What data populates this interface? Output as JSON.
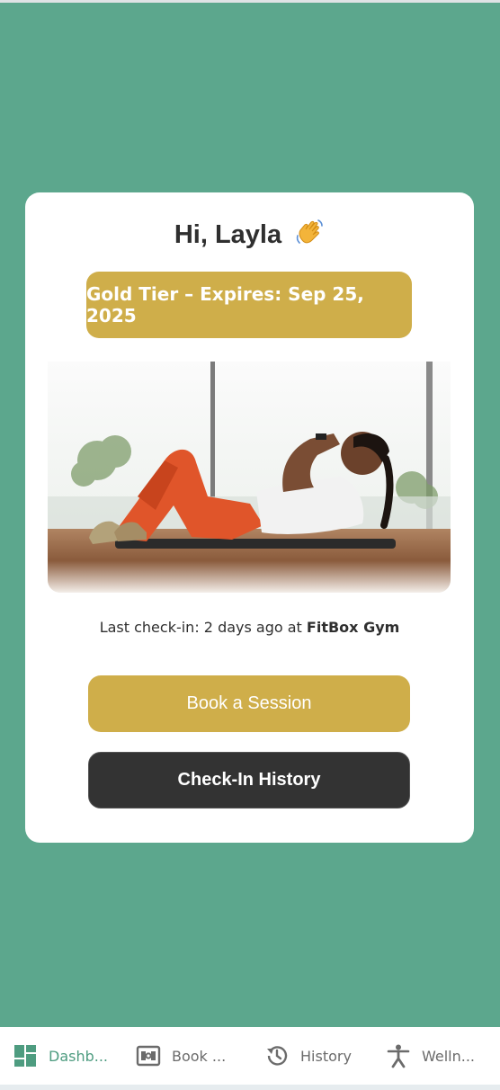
{
  "greeting": {
    "text": "Hi, Layla",
    "icon": "waving-hand-icon"
  },
  "membership": {
    "tier_text": "Gold Tier – Expires: Sep 25, 2025"
  },
  "hero_image": {
    "icon": "woman-doing-crunches-photo"
  },
  "last_checkin": {
    "prefix": "Last check-in: 2 days ago at ",
    "gym": "FitBox Gym"
  },
  "actions": {
    "book_label": "Book a Session",
    "history_label": "Check-In History"
  },
  "nav": {
    "items": [
      {
        "label": "Dashb...",
        "icon": "dashboard-icon",
        "active": true
      },
      {
        "label": "Book ...",
        "icon": "calendar-board-icon",
        "active": false
      },
      {
        "label": "History",
        "icon": "history-icon",
        "active": false
      },
      {
        "label": "Welln...",
        "icon": "wellness-figure-icon",
        "active": false
      }
    ]
  },
  "colors": {
    "background": "#5ca78d",
    "gold": "#cfae4a",
    "dark": "#333333",
    "nav_active": "#4e9c80"
  }
}
